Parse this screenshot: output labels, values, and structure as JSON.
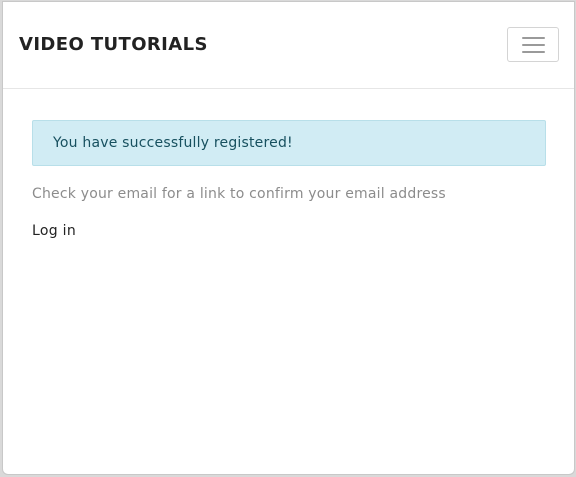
{
  "navbar": {
    "brand": "VIDEO TUTORIALS",
    "menu_icon": "hamburger-menu-icon"
  },
  "alert": {
    "message": "You have successfully registered!",
    "background": "#d1ecf4",
    "text_color": "#17505f"
  },
  "main": {
    "info_text": "Check your email for a link to confirm your email address",
    "login_link": "Log in"
  }
}
